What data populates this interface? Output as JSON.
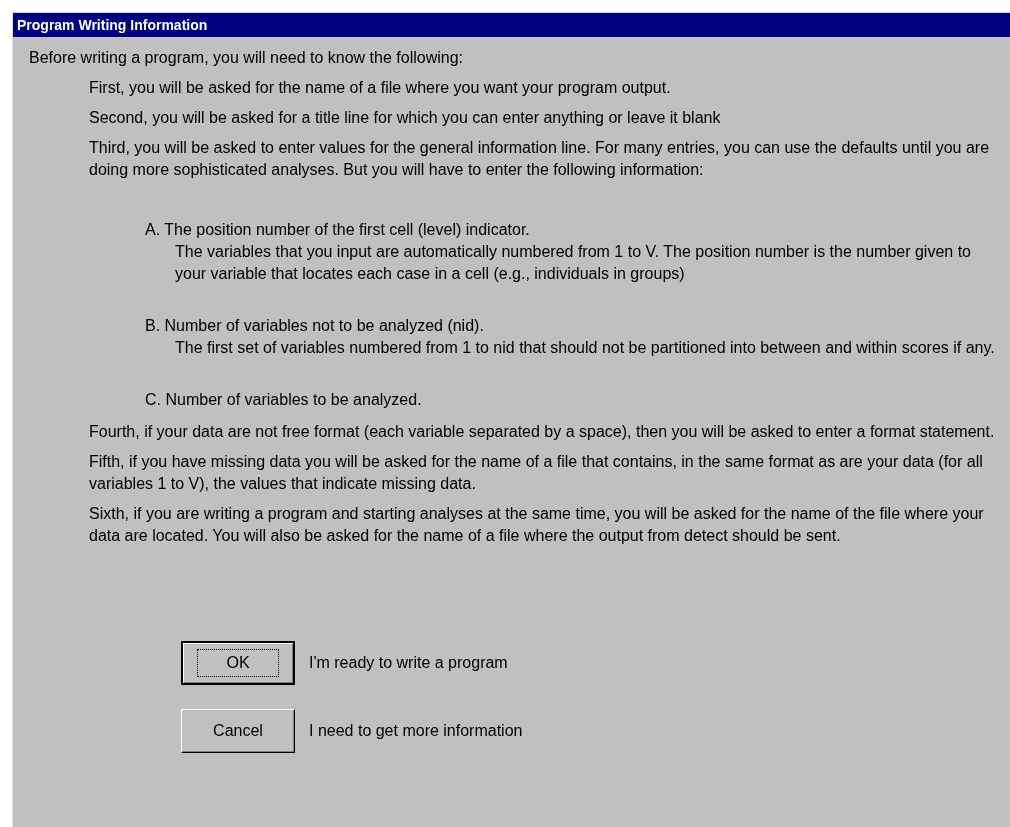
{
  "window": {
    "title": "Program Writing Information"
  },
  "intro": "Before writing a program, you will need to know the following:",
  "steps": [
    {
      "text": "First, you will be asked for the name of a file where you want your program output."
    },
    {
      "text": "Second, you will be asked for a title line for which you can enter anything or leave it blank"
    },
    {
      "text": "Third, you will be asked to enter values for the general information line. For many entries, you can use the defaults until you are doing more sophisticated analyses. But you will have to enter the following information:",
      "children": [
        {
          "text": "A. The position number of the first cell (level) indicator.",
          "detail": "The variables that you input are automatically numbered from 1 to V. The position number is the number given to your variable that locates each case in a cell (e.g., individuals in groups)"
        },
        {
          "text": "B. Number of variables not to be analyzed (nid).",
          "detail": "The first set of variables numbered from 1 to nid that should not be partitioned into between and within scores if any."
        },
        {
          "text": "C. Number of variables to be analyzed."
        }
      ]
    },
    {
      "text": "Fourth, if your data are not free format (each variable separated by a space), then you will be asked to enter a format statement."
    },
    {
      "text": "Fifth, if you have missing data you will be asked for the name of a file that contains, in the same format as are your data (for all variables 1 to V), the values that indicate missing data."
    },
    {
      "text": "Sixth, if you are writing a program and starting analyses at the same time, you will be asked for the name of the file where your data are located. You will also be asked for the name of a file where the output from detect should be sent."
    }
  ],
  "buttons": [
    {
      "label": "OK",
      "default": true,
      "description": "I'm ready to write a program"
    },
    {
      "label": "Cancel",
      "default": false,
      "description": "I need to get more information"
    }
  ]
}
